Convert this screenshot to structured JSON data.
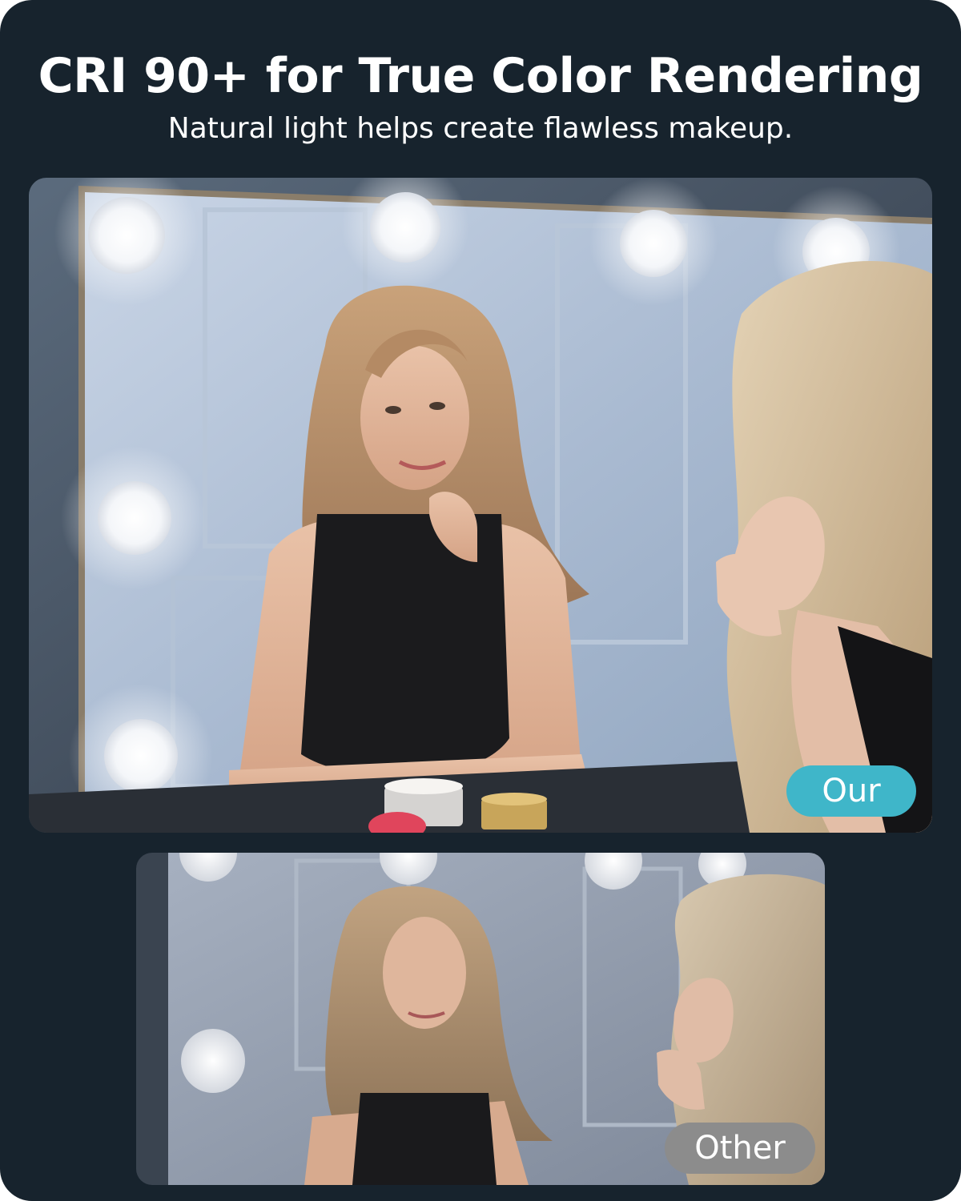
{
  "header": {
    "title": "CRI 90+ for True Color Rendering",
    "subtitle": "Natural light helps create flawless makeup."
  },
  "comparison": {
    "ours_label": "Our",
    "other_label": "Other"
  },
  "colors": {
    "background": "#17232d",
    "ours_badge": "#3fb6c9",
    "other_badge": "#8c8c8c"
  }
}
